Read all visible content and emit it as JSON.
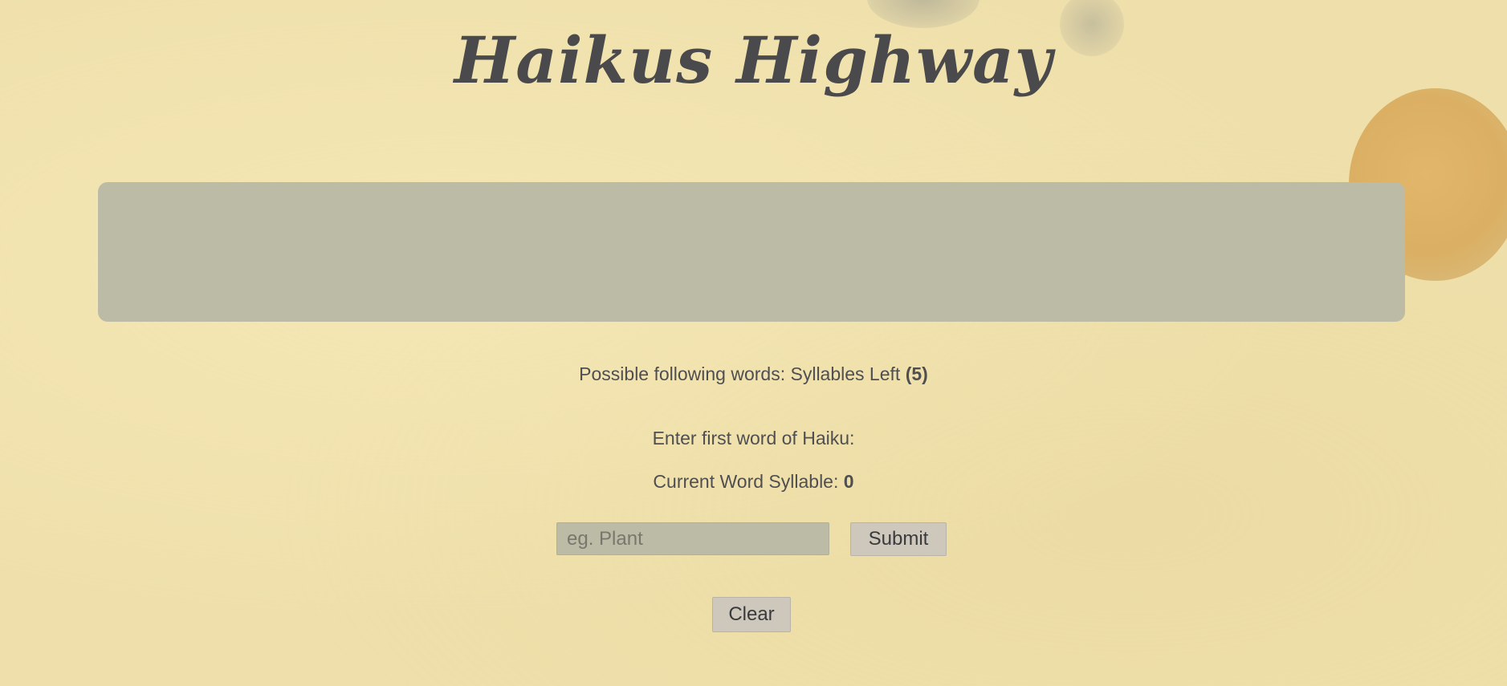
{
  "app": {
    "title": "Haikus Highway"
  },
  "haiku_display": {
    "lines": []
  },
  "suggestions": {
    "label": "Possible following words: Syllables Left",
    "syllables_left": "(5)"
  },
  "prompt": {
    "text": "Enter first word of Haiku:"
  },
  "current_word": {
    "label": "Current Word Syllable:",
    "value": "0"
  },
  "form": {
    "input_value": "",
    "input_placeholder": "eg. Plant",
    "submit_label": "Submit",
    "clear_label": "Clear"
  },
  "colors": {
    "background": "#efe0ab",
    "panel": "#bcbba6",
    "text": "#4a4a4c",
    "button": "#cdc7bc"
  }
}
